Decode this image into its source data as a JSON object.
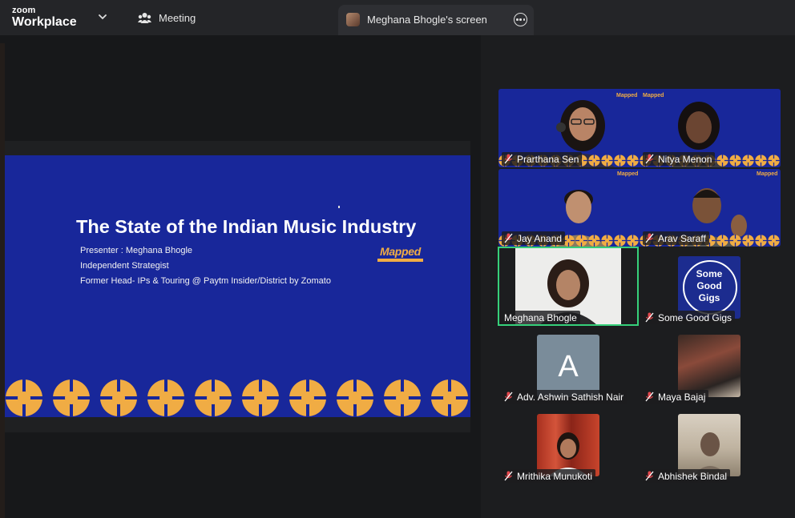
{
  "app": {
    "brand_small": "zoom",
    "brand_name": "Workplace"
  },
  "tabs": {
    "meeting_label": "Meeting",
    "screen_label": "Meghana Bhogle's screen"
  },
  "slide": {
    "title": "The State of the Indian Music Industry",
    "lines": [
      "Presenter : Meghana Bhogle",
      "Independent Strategist",
      "Former Head- IPs & Touring @ Paytm Insider/District by Zomato"
    ],
    "logo_text": "Mapped",
    "background_color": "#18279a",
    "accent_color": "#f0ac44"
  },
  "participants": [
    {
      "name": "Prarthana Sen",
      "muted": true
    },
    {
      "name": "Nitya Menon",
      "muted": true
    },
    {
      "name": "Jay Anand",
      "muted": true
    },
    {
      "name": "Arav Saraff",
      "muted": true
    },
    {
      "name": "Meghana Bhogle",
      "muted": false,
      "active_speaker": true
    },
    {
      "name": "Some Good Gigs",
      "muted": true
    },
    {
      "name": "Adv. Ashwin Sathish Nair",
      "muted": true
    },
    {
      "name": "Maya Bajaj",
      "muted": true
    },
    {
      "name": "Mrithika Munukoti",
      "muted": true
    },
    {
      "name": "Abhishek Bindal",
      "muted": true
    }
  ],
  "avatars": {
    "ashwin_letter": "A",
    "some_good_gigs_logo": [
      "Some",
      "Good",
      "Gigs"
    ]
  },
  "colors": {
    "active_speaker_border": "#36d07a",
    "muted_icon": "#e5484d"
  }
}
